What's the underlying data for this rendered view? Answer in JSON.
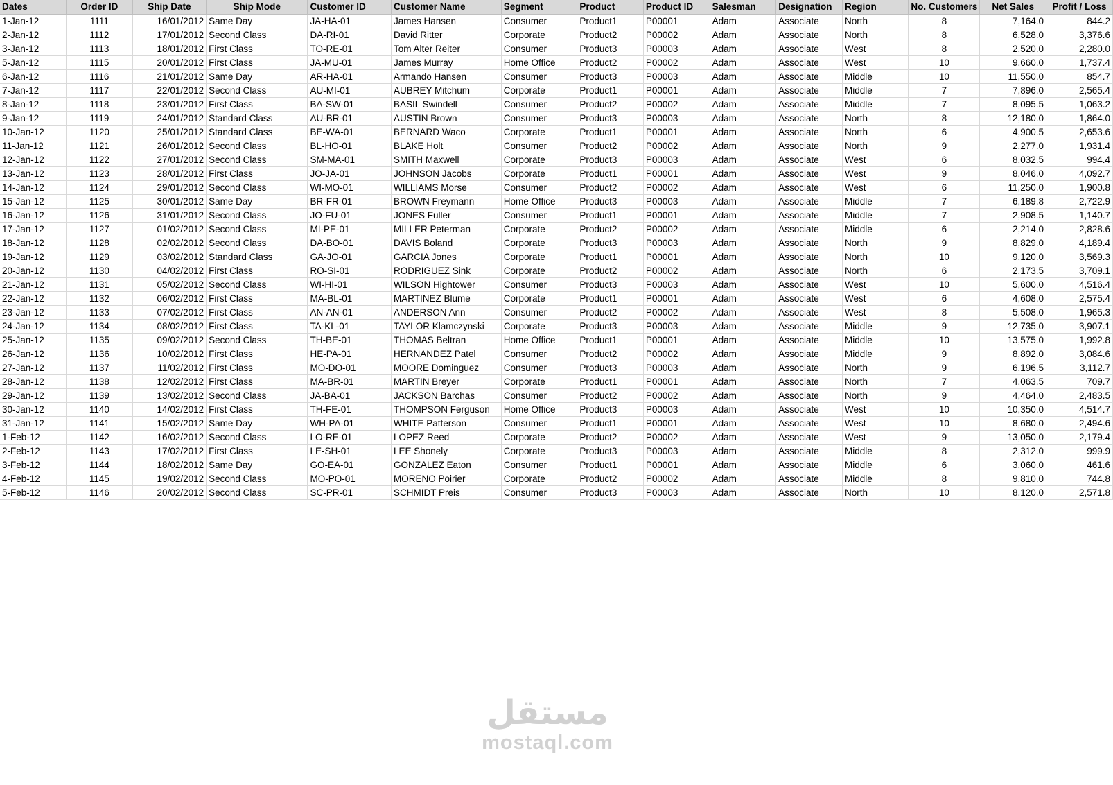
{
  "sheet": {
    "headers": [
      "Dates",
      "Order ID",
      "Ship Date",
      "Ship Mode",
      "Customer ID",
      "Customer Name",
      "Segment",
      "Product",
      "Product ID",
      "Salesman",
      "Designation",
      "Region",
      "No. Customers",
      "Net Sales",
      "Profit / Loss"
    ],
    "rows": [
      [
        "1-Jan-12",
        "1111",
        "16/01/2012",
        "Same Day",
        "JA-HA-01",
        "James Hansen",
        "Consumer",
        "Product1",
        "P00001",
        "Adam",
        "Associate",
        "North",
        "8",
        "7,164.0",
        "844.2"
      ],
      [
        "2-Jan-12",
        "1112",
        "17/01/2012",
        "Second Class",
        "DA-RI-01",
        "David Ritter",
        "Corporate",
        "Product2",
        "P00002",
        "Adam",
        "Associate",
        "North",
        "8",
        "6,528.0",
        "3,376.6"
      ],
      [
        "3-Jan-12",
        "1113",
        "18/01/2012",
        "First Class",
        "TO-RE-01",
        "Tom Alter Reiter",
        "Consumer",
        "Product3",
        "P00003",
        "Adam",
        "Associate",
        "West",
        "8",
        "2,520.0",
        "2,280.0"
      ],
      [
        "5-Jan-12",
        "1115",
        "20/01/2012",
        "First Class",
        "JA-MU-01",
        "James Murray",
        "Home Office",
        "Product2",
        "P00002",
        "Adam",
        "Associate",
        "West",
        "10",
        "9,660.0",
        "1,737.4"
      ],
      [
        "6-Jan-12",
        "1116",
        "21/01/2012",
        "Same Day",
        "AR-HA-01",
        "Armando Hansen",
        "Consumer",
        "Product3",
        "P00003",
        "Adam",
        "Associate",
        "Middle",
        "10",
        "11,550.0",
        "854.7"
      ],
      [
        "7-Jan-12",
        "1117",
        "22/01/2012",
        "Second Class",
        "AU-MI-01",
        "AUBREY Mitchum",
        "Corporate",
        "Product1",
        "P00001",
        "Adam",
        "Associate",
        "Middle",
        "7",
        "7,896.0",
        "2,565.4"
      ],
      [
        "8-Jan-12",
        "1118",
        "23/01/2012",
        "First Class",
        "BA-SW-01",
        "BASIL Swindell",
        "Consumer",
        "Product2",
        "P00002",
        "Adam",
        "Associate",
        "Middle",
        "7",
        "8,095.5",
        "1,063.2"
      ],
      [
        "9-Jan-12",
        "1119",
        "24/01/2012",
        "Standard Class",
        "AU-BR-01",
        "AUSTIN Brown",
        "Consumer",
        "Product3",
        "P00003",
        "Adam",
        "Associate",
        "North",
        "8",
        "12,180.0",
        "1,864.0"
      ],
      [
        "10-Jan-12",
        "1120",
        "25/01/2012",
        "Standard Class",
        "BE-WA-01",
        "BERNARD Waco",
        "Corporate",
        "Product1",
        "P00001",
        "Adam",
        "Associate",
        "North",
        "6",
        "4,900.5",
        "2,653.6"
      ],
      [
        "11-Jan-12",
        "1121",
        "26/01/2012",
        "Second Class",
        "BL-HO-01",
        "BLAKE Holt",
        "Consumer",
        "Product2",
        "P00002",
        "Adam",
        "Associate",
        "North",
        "9",
        "2,277.0",
        "1,931.4"
      ],
      [
        "12-Jan-12",
        "1122",
        "27/01/2012",
        "Second Class",
        "SM-MA-01",
        "SMITH Maxwell",
        "Corporate",
        "Product3",
        "P00003",
        "Adam",
        "Associate",
        "West",
        "6",
        "8,032.5",
        "994.4"
      ],
      [
        "13-Jan-12",
        "1123",
        "28/01/2012",
        "First Class",
        "JO-JA-01",
        "JOHNSON Jacobs",
        "Corporate",
        "Product1",
        "P00001",
        "Adam",
        "Associate",
        "West",
        "9",
        "8,046.0",
        "4,092.7"
      ],
      [
        "14-Jan-12",
        "1124",
        "29/01/2012",
        "Second Class",
        "WI-MO-01",
        "WILLIAMS Morse",
        "Consumer",
        "Product2",
        "P00002",
        "Adam",
        "Associate",
        "West",
        "6",
        "11,250.0",
        "1,900.8"
      ],
      [
        "15-Jan-12",
        "1125",
        "30/01/2012",
        "Same Day",
        "BR-FR-01",
        "BROWN Freymann",
        "Home Office",
        "Product3",
        "P00003",
        "Adam",
        "Associate",
        "Middle",
        "7",
        "6,189.8",
        "2,722.9"
      ],
      [
        "16-Jan-12",
        "1126",
        "31/01/2012",
        "Second Class",
        "JO-FU-01",
        "JONES Fuller",
        "Consumer",
        "Product1",
        "P00001",
        "Adam",
        "Associate",
        "Middle",
        "7",
        "2,908.5",
        "1,140.7"
      ],
      [
        "17-Jan-12",
        "1127",
        "01/02/2012",
        "Second Class",
        "MI-PE-01",
        "MILLER Peterman",
        "Corporate",
        "Product2",
        "P00002",
        "Adam",
        "Associate",
        "Middle",
        "6",
        "2,214.0",
        "2,828.6"
      ],
      [
        "18-Jan-12",
        "1128",
        "02/02/2012",
        "Second Class",
        "DA-BO-01",
        "DAVIS Boland",
        "Corporate",
        "Product3",
        "P00003",
        "Adam",
        "Associate",
        "North",
        "9",
        "8,829.0",
        "4,189.4"
      ],
      [
        "19-Jan-12",
        "1129",
        "03/02/2012",
        "Standard Class",
        "GA-JO-01",
        "GARCIA Jones",
        "Corporate",
        "Product1",
        "P00001",
        "Adam",
        "Associate",
        "North",
        "10",
        "9,120.0",
        "3,569.3"
      ],
      [
        "20-Jan-12",
        "1130",
        "04/02/2012",
        "First Class",
        "RO-SI-01",
        "RODRIGUEZ Sink",
        "Corporate",
        "Product2",
        "P00002",
        "Adam",
        "Associate",
        "North",
        "6",
        "2,173.5",
        "3,709.1"
      ],
      [
        "21-Jan-12",
        "1131",
        "05/02/2012",
        "Second Class",
        "WI-HI-01",
        "WILSON Hightower",
        "Consumer",
        "Product3",
        "P00003",
        "Adam",
        "Associate",
        "West",
        "10",
        "5,600.0",
        "4,516.4"
      ],
      [
        "22-Jan-12",
        "1132",
        "06/02/2012",
        "First Class",
        "MA-BL-01",
        "MARTINEZ Blume",
        "Corporate",
        "Product1",
        "P00001",
        "Adam",
        "Associate",
        "West",
        "6",
        "4,608.0",
        "2,575.4"
      ],
      [
        "23-Jan-12",
        "1133",
        "07/02/2012",
        "First Class",
        "AN-AN-01",
        "ANDERSON Ann",
        "Consumer",
        "Product2",
        "P00002",
        "Adam",
        "Associate",
        "West",
        "8",
        "5,508.0",
        "1,965.3"
      ],
      [
        "24-Jan-12",
        "1134",
        "08/02/2012",
        "First Class",
        "TA-KL-01",
        "TAYLOR Klamczynski",
        "Corporate",
        "Product3",
        "P00003",
        "Adam",
        "Associate",
        "Middle",
        "9",
        "12,735.0",
        "3,907.1"
      ],
      [
        "25-Jan-12",
        "1135",
        "09/02/2012",
        "Second Class",
        "TH-BE-01",
        "THOMAS Beltran",
        "Home Office",
        "Product1",
        "P00001",
        "Adam",
        "Associate",
        "Middle",
        "10",
        "13,575.0",
        "1,992.8"
      ],
      [
        "26-Jan-12",
        "1136",
        "10/02/2012",
        "First Class",
        "HE-PA-01",
        "HERNANDEZ Patel",
        "Consumer",
        "Product2",
        "P00002",
        "Adam",
        "Associate",
        "Middle",
        "9",
        "8,892.0",
        "3,084.6"
      ],
      [
        "27-Jan-12",
        "1137",
        "11/02/2012",
        "First Class",
        "MO-DO-01",
        "MOORE Dominguez",
        "Consumer",
        "Product3",
        "P00003",
        "Adam",
        "Associate",
        "North",
        "9",
        "6,196.5",
        "3,112.7"
      ],
      [
        "28-Jan-12",
        "1138",
        "12/02/2012",
        "First Class",
        "MA-BR-01",
        "MARTIN Breyer",
        "Corporate",
        "Product1",
        "P00001",
        "Adam",
        "Associate",
        "North",
        "7",
        "4,063.5",
        "709.7"
      ],
      [
        "29-Jan-12",
        "1139",
        "13/02/2012",
        "Second Class",
        "JA-BA-01",
        "JACKSON Barchas",
        "Consumer",
        "Product2",
        "P00002",
        "Adam",
        "Associate",
        "North",
        "9",
        "4,464.0",
        "2,483.5"
      ],
      [
        "30-Jan-12",
        "1140",
        "14/02/2012",
        "First Class",
        "TH-FE-01",
        "THOMPSON Ferguson",
        "Home Office",
        "Product3",
        "P00003",
        "Adam",
        "Associate",
        "West",
        "10",
        "10,350.0",
        "4,514.7"
      ],
      [
        "31-Jan-12",
        "1141",
        "15/02/2012",
        "Same Day",
        "WH-PA-01",
        "WHITE Patterson",
        "Consumer",
        "Product1",
        "P00001",
        "Adam",
        "Associate",
        "West",
        "10",
        "8,680.0",
        "2,494.6"
      ],
      [
        "1-Feb-12",
        "1142",
        "16/02/2012",
        "Second Class",
        "LO-RE-01",
        "LOPEZ Reed",
        "Corporate",
        "Product2",
        "P00002",
        "Adam",
        "Associate",
        "West",
        "9",
        "13,050.0",
        "2,179.4"
      ],
      [
        "2-Feb-12",
        "1143",
        "17/02/2012",
        "First Class",
        "LE-SH-01",
        "LEE Shonely",
        "Corporate",
        "Product3",
        "P00003",
        "Adam",
        "Associate",
        "Middle",
        "8",
        "2,312.0",
        "999.9"
      ],
      [
        "3-Feb-12",
        "1144",
        "18/02/2012",
        "Same Day",
        "GO-EA-01",
        "GONZALEZ Eaton",
        "Consumer",
        "Product1",
        "P00001",
        "Adam",
        "Associate",
        "Middle",
        "6",
        "3,060.0",
        "461.6"
      ],
      [
        "4-Feb-12",
        "1145",
        "19/02/2012",
        "Second Class",
        "MO-PO-01",
        "MORENO Poirier",
        "Corporate",
        "Product2",
        "P00002",
        "Adam",
        "Associate",
        "Middle",
        "8",
        "9,810.0",
        "744.8"
      ],
      [
        "5-Feb-12",
        "1146",
        "20/02/2012",
        "Second Class",
        "SC-PR-01",
        "SCHMIDT Preis",
        "Consumer",
        "Product3",
        "P00003",
        "Adam",
        "Associate",
        "North",
        "10",
        "8,120.0",
        "2,571.8"
      ]
    ]
  },
  "watermark": {
    "arabic": "مستقل",
    "latin": "mostaql.com"
  }
}
